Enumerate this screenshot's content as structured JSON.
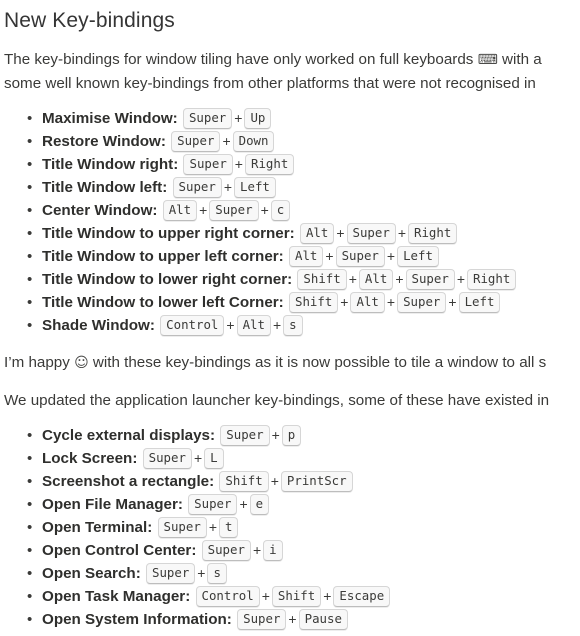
{
  "heading": "New Key-bindings",
  "paragraphs": {
    "intro_before_emoji": "The key-bindings for window tiling have only worked on full keyboards ",
    "keyboard_emoji": "⌨",
    "intro_after_emoji": " with a\nsome well known key-bindings from other platforms that were not recognised in",
    "happy_before_emoji": "I’m happy ",
    "happy_emoji": "☺",
    "happy_after_emoji": " with these key-bindings as it is now possible to tile a window to all s",
    "launcher": "We updated the application launcher key-bindings, some of these have existed in"
  },
  "plus": "+",
  "tiling_bindings": [
    {
      "label": "Maximise Window:",
      "keys": [
        "Super",
        "Up"
      ]
    },
    {
      "label": "Restore Window:",
      "keys": [
        "Super",
        "Down"
      ]
    },
    {
      "label": "Title Window right:",
      "keys": [
        "Super",
        "Right"
      ]
    },
    {
      "label": "Title Window left:",
      "keys": [
        "Super",
        "Left"
      ]
    },
    {
      "label": "Center Window:",
      "keys": [
        "Alt",
        "Super",
        "c"
      ]
    },
    {
      "label": "Title Window to upper right corner:",
      "keys": [
        "Alt",
        "Super",
        "Right"
      ]
    },
    {
      "label": "Title Window to upper left corner:",
      "keys": [
        "Alt",
        "Super",
        "Left"
      ]
    },
    {
      "label": "Title Window to lower right corner:",
      "keys": [
        "Shift",
        "Alt",
        "Super",
        "Right"
      ]
    },
    {
      "label": "Title Window to lower left Corner:",
      "keys": [
        "Shift",
        "Alt",
        "Super",
        "Left"
      ]
    },
    {
      "label": "Shade Window:",
      "keys": [
        "Control",
        "Alt",
        "s"
      ]
    }
  ],
  "launcher_bindings": [
    {
      "label": "Cycle external displays:",
      "keys": [
        "Super",
        "p"
      ]
    },
    {
      "label": "Lock Screen:",
      "keys": [
        "Super",
        "L"
      ]
    },
    {
      "label": "Screenshot a rectangle:",
      "keys": [
        "Shift",
        "PrintScr"
      ]
    },
    {
      "label": "Open File Manager:",
      "keys": [
        "Super",
        "e"
      ]
    },
    {
      "label": "Open Terminal:",
      "keys": [
        "Super",
        "t"
      ]
    },
    {
      "label": "Open Control Center:",
      "keys": [
        "Super",
        "i"
      ]
    },
    {
      "label": "Open Search:",
      "keys": [
        "Super",
        "s"
      ]
    },
    {
      "label": "Open Task Manager:",
      "keys": [
        "Control",
        "Shift",
        "Escape"
      ]
    },
    {
      "label": "Open System Information:",
      "keys": [
        "Super",
        "Pause"
      ]
    }
  ]
}
